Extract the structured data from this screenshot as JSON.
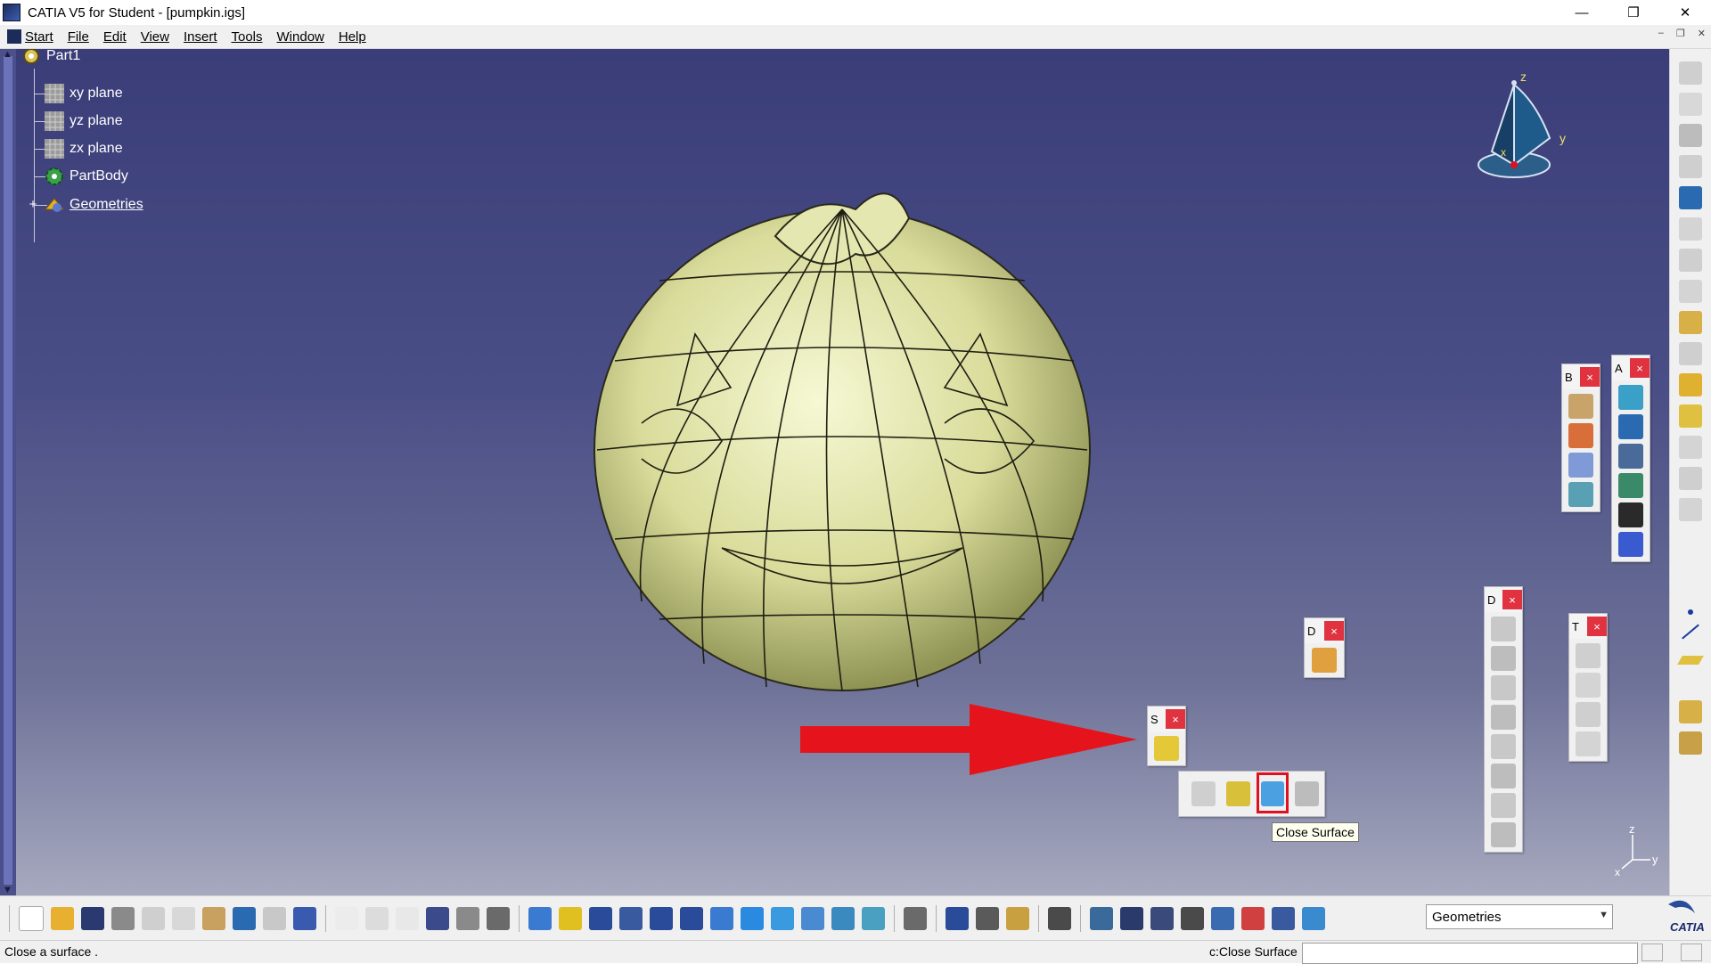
{
  "window": {
    "title": "CATIA V5 for Student - [pumpkin.igs]",
    "controls": [
      "—",
      "❐",
      "✕"
    ],
    "mdi_controls": [
      "–",
      "❐",
      "✕"
    ]
  },
  "menu": {
    "items": [
      {
        "label": "Start"
      },
      {
        "label": "File"
      },
      {
        "label": "Edit"
      },
      {
        "label": "View"
      },
      {
        "label": "Insert"
      },
      {
        "label": "Tools"
      },
      {
        "label": "Window"
      },
      {
        "label": "Help"
      }
    ]
  },
  "tree": {
    "root": "Part1",
    "items": [
      {
        "label": "xy plane",
        "icon": "plane-icon"
      },
      {
        "label": "yz plane",
        "icon": "plane-icon"
      },
      {
        "label": "zx plane",
        "icon": "plane-icon"
      },
      {
        "label": "PartBody",
        "icon": "gear-icon"
      },
      {
        "label": "Geometries",
        "icon": "geometrical-set-icon"
      }
    ]
  },
  "compass": {
    "axes": [
      "z",
      "y",
      "x"
    ]
  },
  "corner_axes": {
    "axes": [
      "z",
      "y",
      "x"
    ]
  },
  "floating_toolbars": {
    "b": {
      "title": "B",
      "close": "×"
    },
    "a": {
      "title": "A",
      "close": "×"
    },
    "d1": {
      "title": "D",
      "close": "×"
    },
    "d2": {
      "title": "D",
      "close": "×"
    },
    "t": {
      "title": "T",
      "close": "×"
    },
    "s": {
      "title": "S",
      "close": "×"
    }
  },
  "tooltip": {
    "text": "Close Surface"
  },
  "geometry_combo": {
    "value": "Geometries"
  },
  "status": {
    "message": "Close a surface .",
    "command_label": "c:Close Surface",
    "command_input": ""
  },
  "colors": {
    "viewport_top": "#3a3d78",
    "viewport_bottom": "#a7a9bf",
    "model": "#e3e6aa",
    "highlight": "#e01020",
    "tooltip_bg": "#fffff0"
  }
}
